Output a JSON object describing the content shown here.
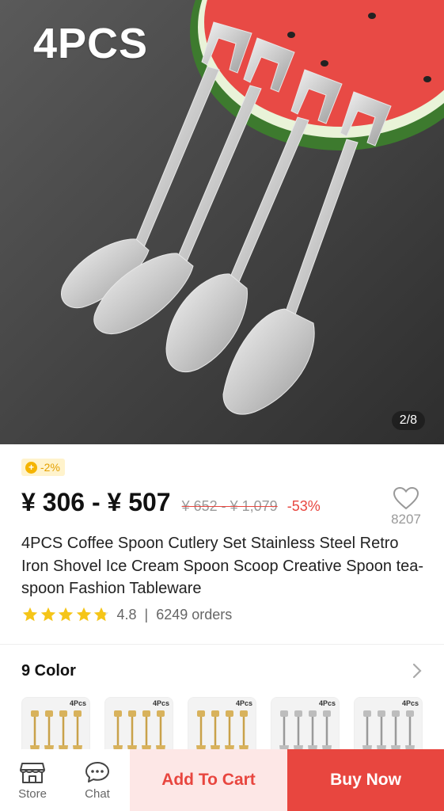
{
  "hero": {
    "caption": "4PCS",
    "image_counter": "2/8"
  },
  "price": {
    "coin_icon": "coin-icon",
    "discount_badge": "-2%",
    "current_range": "¥ 306 - ¥ 507",
    "original_range": "¥ 652 - ¥ 1,079",
    "percent_off": "-53%"
  },
  "wishlist": {
    "icon": "heart-icon",
    "count": "8207"
  },
  "product": {
    "title": "4PCS Coffee Spoon Cutlery Set Stainless Steel Retro Iron Shovel Ice Cream Spoon Scoop Creative Spoon tea-spoon Fashion Tableware",
    "rating": "4.8",
    "separator": "|",
    "orders": "6249 orders",
    "stars_filled": 4.8
  },
  "variants": {
    "title": "9 Color",
    "thumb_label": "4Pcs",
    "items": [
      {
        "finish": "gold"
      },
      {
        "finish": "gold"
      },
      {
        "finish": "gold"
      },
      {
        "finish": "silver"
      },
      {
        "finish": "silver"
      }
    ]
  },
  "bottom_bar": {
    "store_label": "Store",
    "chat_label": "Chat",
    "add_to_cart_label": "Add To Cart",
    "buy_now_label": "Buy Now"
  },
  "colors": {
    "accent_red": "#e8463f",
    "cart_bg": "#fde7e6",
    "star_yellow": "#f5c518",
    "badge_bg": "#fff3cc"
  }
}
